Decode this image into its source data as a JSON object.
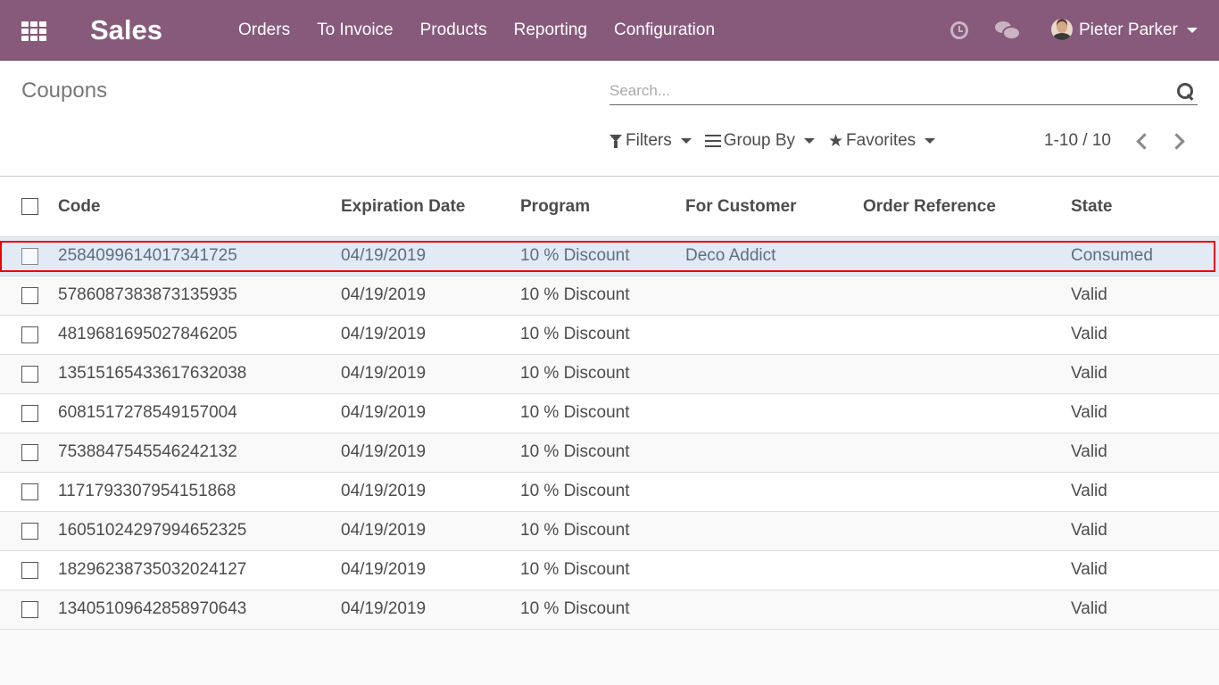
{
  "navbar": {
    "brand": "Sales",
    "menu": [
      "Orders",
      "To Invoice",
      "Products",
      "Reporting",
      "Configuration"
    ],
    "user": "Pieter Parker",
    "icons": [
      "apps-icon",
      "clock-icon",
      "chat-icon",
      "avatar",
      "chevron-down-icon"
    ]
  },
  "control_panel": {
    "breadcrumb": "Coupons",
    "search": {
      "placeholder": "Search...",
      "value": ""
    },
    "filters_label": "Filters",
    "group_by_label": "Group By",
    "favorites_label": "Favorites",
    "pager_value": "1-10 / 10"
  },
  "table": {
    "headers": {
      "code": "Code",
      "expiration": "Expiration Date",
      "program": "Program",
      "customer": "For Customer",
      "order_ref": "Order Reference",
      "state": "State"
    },
    "rows": [
      {
        "code": "2584099614017341725",
        "expiration": "04/19/2019",
        "program": "10 % Discount",
        "customer": "Deco Addict",
        "order_ref": "",
        "state": "Consumed"
      },
      {
        "code": "5786087383873135935",
        "expiration": "04/19/2019",
        "program": "10 % Discount",
        "customer": "",
        "order_ref": "",
        "state": "Valid"
      },
      {
        "code": "4819681695027846205",
        "expiration": "04/19/2019",
        "program": "10 % Discount",
        "customer": "",
        "order_ref": "",
        "state": "Valid"
      },
      {
        "code": "13515165433617632038",
        "expiration": "04/19/2019",
        "program": "10 % Discount",
        "customer": "",
        "order_ref": "",
        "state": "Valid"
      },
      {
        "code": "6081517278549157004",
        "expiration": "04/19/2019",
        "program": "10 % Discount",
        "customer": "",
        "order_ref": "",
        "state": "Valid"
      },
      {
        "code": "7538847545546242132",
        "expiration": "04/19/2019",
        "program": "10 % Discount",
        "customer": "",
        "order_ref": "",
        "state": "Valid"
      },
      {
        "code": "1171793307954151868",
        "expiration": "04/19/2019",
        "program": "10 % Discount",
        "customer": "",
        "order_ref": "",
        "state": "Valid"
      },
      {
        "code": "16051024297994652325",
        "expiration": "04/19/2019",
        "program": "10 % Discount",
        "customer": "",
        "order_ref": "",
        "state": "Valid"
      },
      {
        "code": "18296238735032024127",
        "expiration": "04/19/2019",
        "program": "10 % Discount",
        "customer": "",
        "order_ref": "",
        "state": "Valid"
      },
      {
        "code": "13405109642858970643",
        "expiration": "04/19/2019",
        "program": "10 % Discount",
        "customer": "",
        "order_ref": "",
        "state": "Valid"
      }
    ]
  },
  "colors": {
    "navbar": "#875a7b",
    "selected_row": "#e2eaf6",
    "highlight_outline": "#ee0000"
  }
}
